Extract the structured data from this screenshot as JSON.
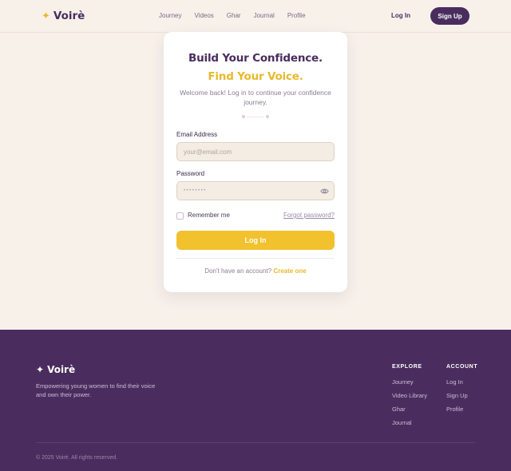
{
  "brand": {
    "name": "Voirè",
    "star": "✦"
  },
  "nav": {
    "items": [
      "Journey",
      "Videos",
      "Ghar",
      "Journal",
      "Profile"
    ],
    "login": "Log In",
    "signup": "Sign Up"
  },
  "card": {
    "title_main": "Build Your Confidence.",
    "title_accent": "Find Your Voice.",
    "subtitle": "Welcome back! Log in to continue your confidence journey.",
    "email_label": "Email Address",
    "email_placeholder": "your@email.com",
    "password_label": "Password",
    "password_mask": "••••••••",
    "remember_label": "Remember me",
    "forgot_label": "Forgot password?",
    "login_button": "Log In",
    "no_account": "Don't have an account?",
    "create_link": "Create one"
  },
  "footer": {
    "tagline": "Empowering young women to find their voice and own their power.",
    "explore": {
      "heading": "EXPLORE",
      "links": [
        "Journey",
        "Video Library",
        "Ghar",
        "Journal"
      ]
    },
    "account": {
      "heading": "ACCOUNT",
      "links": [
        "Log In",
        "Sign Up",
        "Profile"
      ]
    },
    "copyright": "© 2025 Voirè. All rights reserved."
  },
  "colors": {
    "primary": "#4a2d5e",
    "accent": "#e8b92c",
    "button": "#f2c12e",
    "background": "#f7f1ea"
  }
}
